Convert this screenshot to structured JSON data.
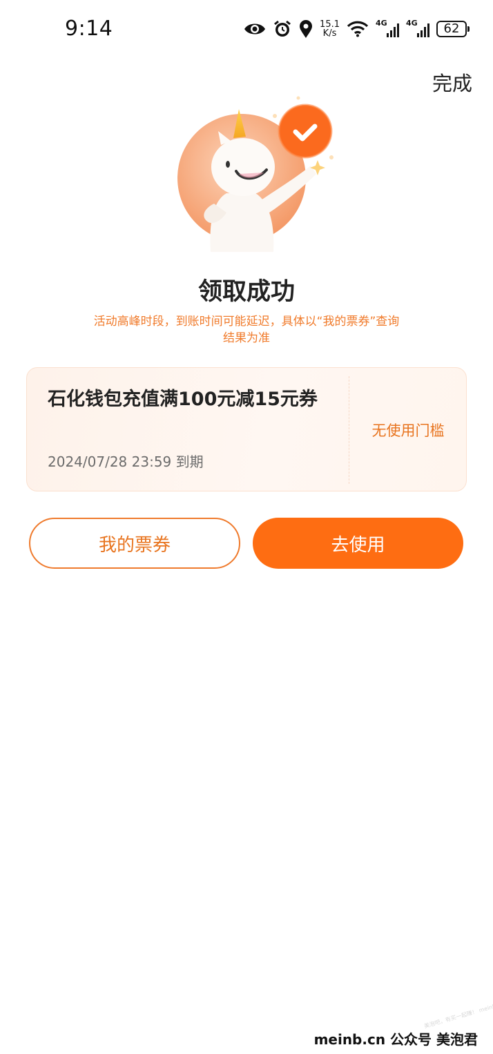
{
  "status_bar": {
    "time": "9:14",
    "net_speed_value": "15.1",
    "net_speed_unit": "K/s",
    "sim1_label": "4G",
    "sim2_label": "4G",
    "battery": "62",
    "icons": [
      "eye-icon",
      "alarm-icon",
      "location-icon",
      "wifi-icon",
      "signal-icon",
      "battery-icon"
    ]
  },
  "header": {
    "done_label": "完成"
  },
  "result": {
    "title": "领取成功",
    "notice": "活动高峰时段，到账时间可能延迟，具体以“我的票券”查询结果为准"
  },
  "coupon": {
    "name": "石化钱包充值满100元减15元券",
    "expiry": "2024/07/28 23:59 到期",
    "threshold": "无使用门槛"
  },
  "actions": {
    "my_coupons_label": "我的票券",
    "use_label": "去使用"
  },
  "watermark": {
    "text": "meinb.cn  公众号 美泡君",
    "faint_text": "美泡吧，有买一起赚！ meinb.com"
  },
  "colors": {
    "accent": "#fe6d12",
    "accent_text": "#e8741f",
    "coupon_bg": "#fef2ea"
  }
}
